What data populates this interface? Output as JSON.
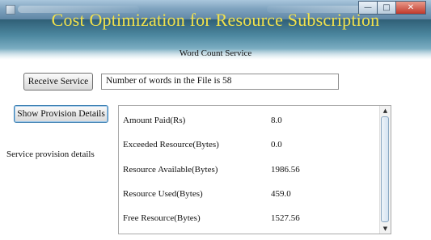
{
  "banner": {
    "title": "Cost Optimization for Resource Subscription",
    "subtitle": "Word Count Service"
  },
  "controls": {
    "receive_label": "Receive Service",
    "message_value": "Number of words in the File is 58",
    "provision_label": "Show Provision Details",
    "side_label": "Service provision details"
  },
  "details": {
    "rows": [
      {
        "label": "Amount Paid(Rs)",
        "value": "8.0"
      },
      {
        "label": "Exceeded Resource(Bytes)",
        "value": "0.0"
      },
      {
        "label": "Resource Available(Bytes)",
        "value": "1986.56"
      },
      {
        "label": "Resource Used(Bytes)",
        "value": "459.0"
      },
      {
        "label": "Free Resource(Bytes)",
        "value": "1527.56"
      }
    ]
  },
  "icons": {
    "window_icon": "app-icon",
    "minimize": "minimize-icon",
    "maximize": "maximize-icon",
    "close": "close-icon",
    "scroll_up": "scroll-up-arrow-icon",
    "scroll_down": "scroll-down-arrow-icon"
  },
  "colors": {
    "title_text": "#f3e24b",
    "banner_top": "#2f5f76",
    "banner_mid": "#7fb0c4",
    "button_focus": "#3c7fb1"
  }
}
